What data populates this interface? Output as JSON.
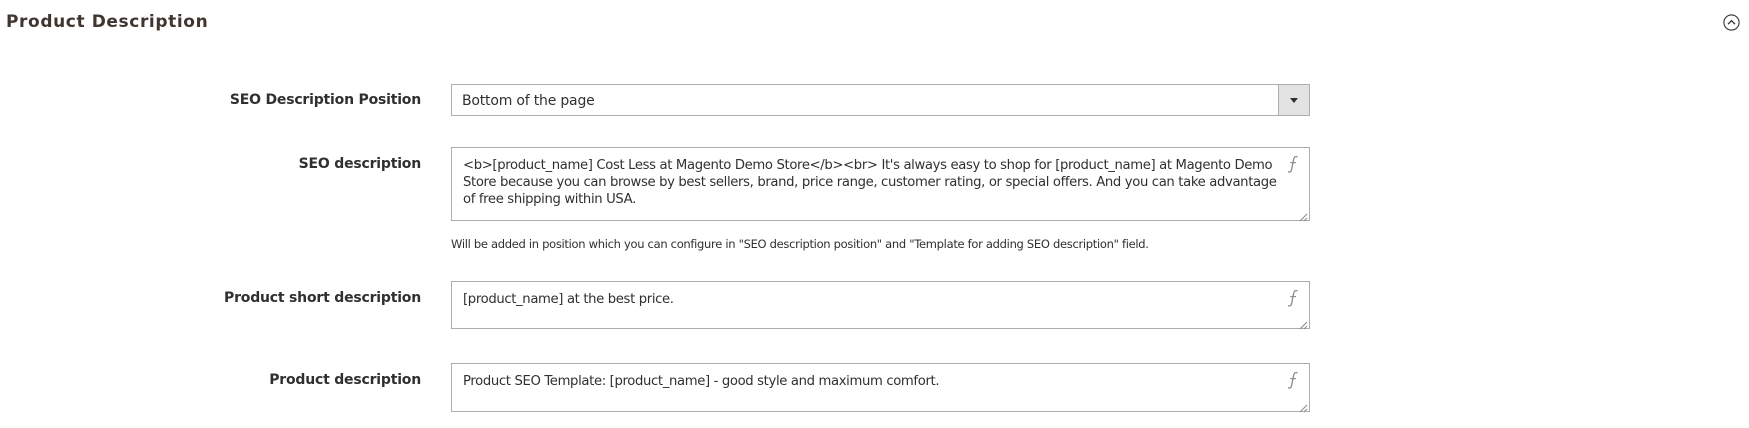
{
  "section": {
    "title": "Product Description"
  },
  "fields": {
    "seo_position": {
      "label": "SEO Description Position",
      "value": "Bottom of the page"
    },
    "seo_description": {
      "label": "SEO description",
      "value": "<b>[product_name] Cost Less at Magento Demo Store</b><br> It's always easy to shop for [product_name] at Magento Demo Store because you can browse by best sellers, brand, price range, customer rating, or special offers. And you can take advantage of free shipping within USA.",
      "note": "Will be added in position which you can configure in \"SEO description position\" and \"Template for adding SEO description\" field."
    },
    "short_description": {
      "label": "Product short description",
      "value": "[product_name] at the best price."
    },
    "description": {
      "label": "Product description",
      "value": "Product SEO Template: [product_name] - good style and maximum comfort."
    }
  },
  "icons": {
    "collapse": "chevron-up-circle-icon",
    "insert_variable": "function-icon",
    "select_arrow": "caret-down-icon"
  },
  "colors": {
    "title": "#41362f",
    "text": "#303030",
    "border": "#adadad",
    "select_arrow_bg": "#e3e3e3"
  }
}
